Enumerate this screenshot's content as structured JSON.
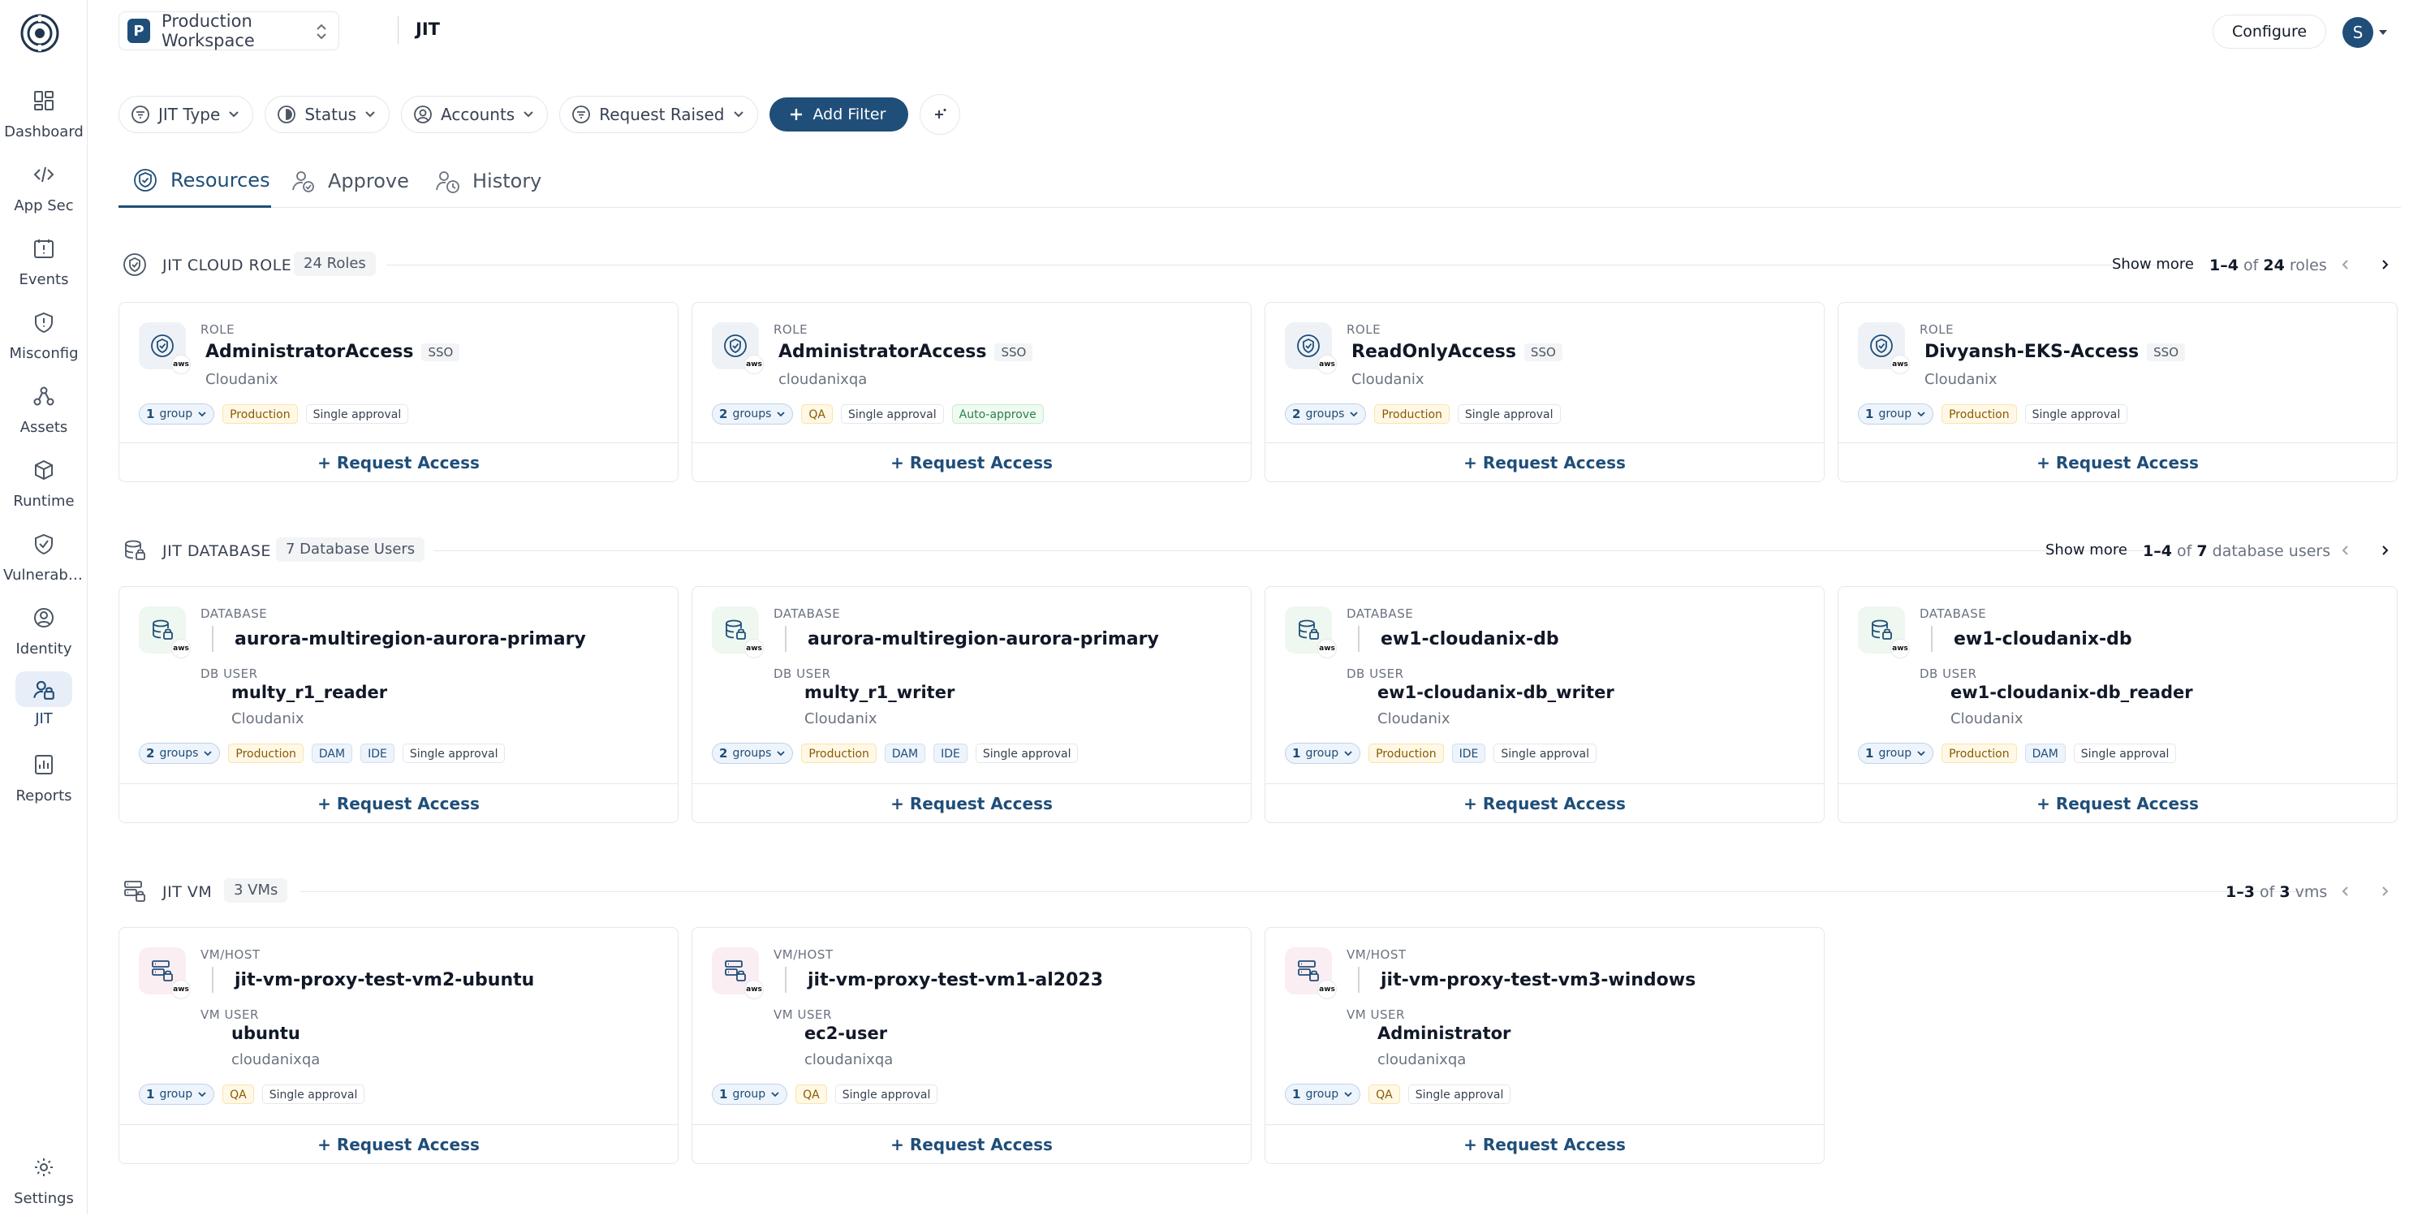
{
  "sidebar": {
    "items": [
      {
        "label": "Dashboard",
        "icon": "dashboard-icon"
      },
      {
        "label": "App Sec",
        "icon": "code-icon"
      },
      {
        "label": "Events",
        "icon": "calendar-alert-icon"
      },
      {
        "label": "Misconfig",
        "icon": "shield-alert-icon"
      },
      {
        "label": "Assets",
        "icon": "network-icon"
      },
      {
        "label": "Runtime",
        "icon": "cube-icon"
      },
      {
        "label": "Vulnerabili...",
        "icon": "shield-check-icon"
      },
      {
        "label": "Identity",
        "icon": "identity-icon"
      },
      {
        "label": "JIT",
        "icon": "jit-icon"
      },
      {
        "label": "Reports",
        "icon": "reports-icon"
      }
    ],
    "settings": "Settings"
  },
  "header": {
    "workspace_initial": "P",
    "workspace_name": "Production Workspace",
    "crumb": "JIT",
    "configure": "Configure",
    "avatar_initial": "S"
  },
  "filters": {
    "jit_type": "JIT Type",
    "status": "Status",
    "accounts": "Accounts",
    "request_raised": "Request Raised",
    "add_filter": "Add Filter"
  },
  "tabs": {
    "resources": "Resources",
    "approve": "Approve",
    "history": "History"
  },
  "request_access": "+ Request Access",
  "show_more": "Show more",
  "sections": {
    "cloud": {
      "title": "JIT CLOUD ROLE",
      "count": "24 Roles",
      "range": "1–4",
      "of": "of",
      "total": "24",
      "unit": "roles",
      "cards": [
        {
          "type": "ROLE",
          "name": "AdministratorAccess",
          "sso": "SSO",
          "account": "Cloudanix",
          "groups_n": "1",
          "groups_lbl": "group",
          "tags": [
            "Production",
            "Single approval"
          ]
        },
        {
          "type": "ROLE",
          "name": "AdministratorAccess",
          "sso": "SSO",
          "account": "cloudanixqa",
          "groups_n": "2",
          "groups_lbl": "groups",
          "tags": [
            "QA",
            "Single approval",
            "Auto-approve"
          ]
        },
        {
          "type": "ROLE",
          "name": "ReadOnlyAccess",
          "sso": "SSO",
          "account": "Cloudanix",
          "groups_n": "2",
          "groups_lbl": "groups",
          "tags": [
            "Production",
            "Single approval"
          ]
        },
        {
          "type": "ROLE",
          "name": "Divyansh-EKS-Access",
          "sso": "SSO",
          "account": "Cloudanix",
          "groups_n": "1",
          "groups_lbl": "group",
          "tags": [
            "Production",
            "Single approval"
          ]
        }
      ]
    },
    "database": {
      "title": "JIT DATABASE",
      "count": "7 Database Users",
      "range": "1–4",
      "of": "of",
      "total": "7",
      "unit": "database users",
      "cards": [
        {
          "type": "DATABASE",
          "name": "aurora-multiregion-aurora-primary",
          "user_label": "DB USER",
          "user": "multy_r1_reader",
          "account": "Cloudanix",
          "groups_n": "2",
          "groups_lbl": "groups",
          "tags": [
            "Production",
            "DAM",
            "IDE",
            "Single approval"
          ]
        },
        {
          "type": "DATABASE",
          "name": "aurora-multiregion-aurora-primary",
          "user_label": "DB USER",
          "user": "multy_r1_writer",
          "account": "Cloudanix",
          "groups_n": "2",
          "groups_lbl": "groups",
          "tags": [
            "Production",
            "DAM",
            "IDE",
            "Single approval"
          ]
        },
        {
          "type": "DATABASE",
          "name": "ew1-cloudanix-db",
          "user_label": "DB USER",
          "user": "ew1-cloudanix-db_writer",
          "account": "Cloudanix",
          "groups_n": "1",
          "groups_lbl": "group",
          "tags": [
            "Production",
            "IDE",
            "Single approval"
          ]
        },
        {
          "type": "DATABASE",
          "name": "ew1-cloudanix-db",
          "user_label": "DB USER",
          "user": "ew1-cloudanix-db_reader",
          "account": "Cloudanix",
          "groups_n": "1",
          "groups_lbl": "group",
          "tags": [
            "Production",
            "DAM",
            "Single approval"
          ]
        }
      ]
    },
    "vm": {
      "title": "JIT VM",
      "count": "3 VMs",
      "range": "1–3",
      "of": "of",
      "total": "3",
      "unit": "vms",
      "cards": [
        {
          "type": "VM/HOST",
          "name": "jit-vm-proxy-test-vm2-ubuntu",
          "user_label": "VM USER",
          "user": "ubuntu",
          "account": "cloudanixqa",
          "groups_n": "1",
          "groups_lbl": "group",
          "tags": [
            "QA",
            "Single approval"
          ]
        },
        {
          "type": "VM/HOST",
          "name": "jit-vm-proxy-test-vm1-al2023",
          "user_label": "VM USER",
          "user": "ec2-user",
          "account": "cloudanixqa",
          "groups_n": "1",
          "groups_lbl": "group",
          "tags": [
            "QA",
            "Single approval"
          ]
        },
        {
          "type": "VM/HOST",
          "name": "jit-vm-proxy-test-vm3-windows",
          "user_label": "VM USER",
          "user": "Administrator",
          "account": "cloudanixqa",
          "groups_n": "1",
          "groups_lbl": "group",
          "tags": [
            "QA",
            "Single approval"
          ]
        }
      ]
    }
  },
  "colors": {
    "brand": "#1f4e79",
    "role_icon_bg": "#eef2f7",
    "db_icon_bg": "#eef7f0",
    "vm_icon_bg": "#fbeef2"
  }
}
